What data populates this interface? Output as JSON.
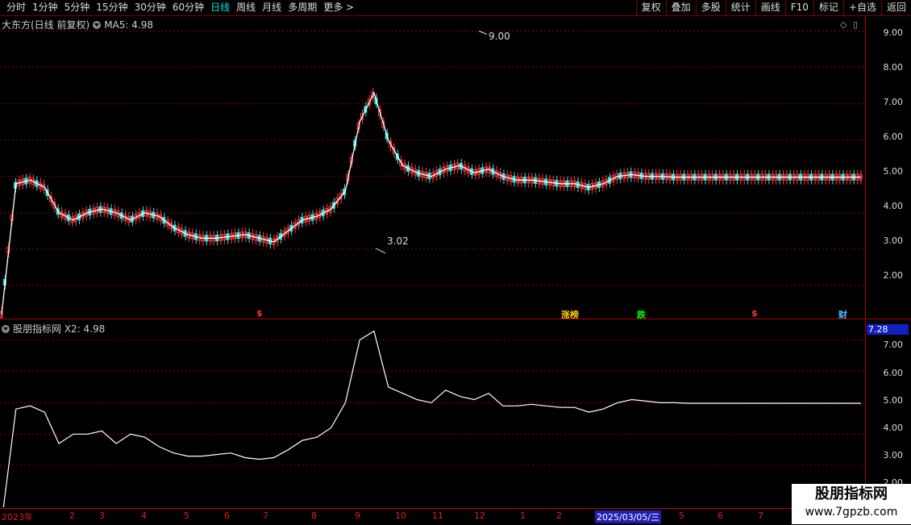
{
  "toolbar": {
    "periods": [
      "分时",
      "1分钟",
      "5分钟",
      "15分钟",
      "30分钟",
      "60分钟",
      "日线",
      "周线",
      "月线",
      "多周期",
      "更多 >"
    ],
    "active_period": "日线",
    "right_buttons": [
      "复权",
      "叠加",
      "多股",
      "统计",
      "画线",
      "F10",
      "标记",
      "+自选",
      "返回"
    ]
  },
  "main_panel": {
    "title": "大东方(日线 前复权)",
    "ma_label": "MA5: 4.98",
    "high_marker": "9.00",
    "low_marker": "3.02",
    "events": [
      {
        "text": "$",
        "color": "#ff3030"
      },
      {
        "text": "涨榜",
        "color": "#ffd000"
      },
      {
        "text": "跌",
        "color": "#00ff00"
      },
      {
        "text": "$",
        "color": "#ff3030"
      },
      {
        "text": "财",
        "color": "#40c0ff"
      }
    ],
    "axis_labels": [
      "9.00",
      "8.00",
      "7.00",
      "6.00",
      "5.00",
      "4.00",
      "3.00",
      "2.00"
    ]
  },
  "sub_panel": {
    "title": "股朋指标网 X2: 4.98",
    "current_value": "7.28",
    "axis_labels": [
      "7.00",
      "6.00",
      "5.00",
      "4.00",
      "3.00",
      "2.00"
    ]
  },
  "date_axis": {
    "labels": [
      "2023年",
      "2",
      "3",
      "4",
      "5",
      "6",
      "7",
      "8",
      "9",
      "10",
      "11",
      "12",
      "1",
      "2",
      "2025/03/05/三",
      "5",
      "6",
      "7"
    ]
  },
  "watermark": {
    "line1": "股朋指标网",
    "line2": "www.7gpzb.com"
  },
  "colors": {
    "up": "#ff3c3c",
    "down": "#40e0e0",
    "ma": "#ffffff",
    "grid": "#9a0000",
    "active_tab": "#00e0e0"
  },
  "chart_data": {
    "type": "line",
    "series": [
      {
        "name": "MA5",
        "x": [
          0,
          1,
          2,
          3,
          4,
          5,
          6,
          7,
          8,
          9,
          10,
          11,
          12,
          13,
          14,
          15,
          16,
          17,
          18,
          19,
          20,
          21,
          22,
          23,
          24,
          25,
          26,
          27,
          28,
          29,
          30,
          31,
          32,
          33,
          34,
          35,
          36,
          37,
          38,
          39,
          40,
          41,
          42,
          43,
          44,
          45,
          46,
          47,
          48,
          49,
          50,
          51,
          52,
          53,
          54,
          55,
          56,
          57,
          58,
          59,
          60
        ],
        "values": [
          1.2,
          4.8,
          4.9,
          4.7,
          4.0,
          3.8,
          4.0,
          4.1,
          4.0,
          3.8,
          4.0,
          3.9,
          3.6,
          3.4,
          3.3,
          3.3,
          3.35,
          3.4,
          3.3,
          3.2,
          3.5,
          3.8,
          3.9,
          4.1,
          4.6,
          6.5,
          7.3,
          6.0,
          5.3,
          5.1,
          5.0,
          5.2,
          5.3,
          5.1,
          5.2,
          5.0,
          4.9,
          4.9,
          4.85,
          4.8,
          4.8,
          4.7,
          4.8,
          5.0,
          5.05,
          5.0,
          5.0,
          4.98,
          4.98,
          4.98,
          4.98,
          4.98,
          4.98,
          4.98,
          4.98,
          4.98,
          4.98,
          4.98,
          4.98,
          4.98,
          4.98
        ]
      },
      {
        "name": "X2",
        "x": [
          0,
          1,
          2,
          3,
          4,
          5,
          6,
          7,
          8,
          9,
          10,
          11,
          12,
          13,
          14,
          15,
          16,
          17,
          18,
          19,
          20,
          21,
          22,
          23,
          24,
          25,
          26,
          27,
          28,
          29,
          30,
          31,
          32,
          33,
          34,
          35,
          36,
          37,
          38,
          39,
          40,
          41,
          42,
          43,
          44,
          45,
          46,
          47,
          48,
          49,
          50,
          51,
          52,
          53,
          54,
          55,
          56,
          57,
          58,
          59,
          60
        ],
        "values": [
          1.2,
          4.8,
          4.9,
          4.7,
          3.7,
          4.0,
          4.0,
          4.1,
          3.7,
          4.0,
          3.9,
          3.6,
          3.4,
          3.3,
          3.3,
          3.35,
          3.4,
          3.25,
          3.2,
          3.25,
          3.5,
          3.8,
          3.9,
          4.2,
          5.0,
          7.0,
          7.28,
          5.5,
          5.3,
          5.1,
          5.0,
          5.4,
          5.2,
          5.1,
          5.3,
          4.9,
          4.9,
          4.95,
          4.9,
          4.85,
          4.85,
          4.7,
          4.8,
          5.0,
          5.1,
          5.05,
          5.0,
          5.0,
          4.98,
          4.98,
          4.98,
          4.98,
          4.98,
          4.98,
          4.98,
          4.98,
          4.98,
          4.98,
          4.98,
          4.98,
          4.98
        ]
      }
    ],
    "ylim_main": [
      1.2,
      9.3
    ],
    "ylim_sub": [
      1.8,
      7.5
    ],
    "grid": true
  }
}
